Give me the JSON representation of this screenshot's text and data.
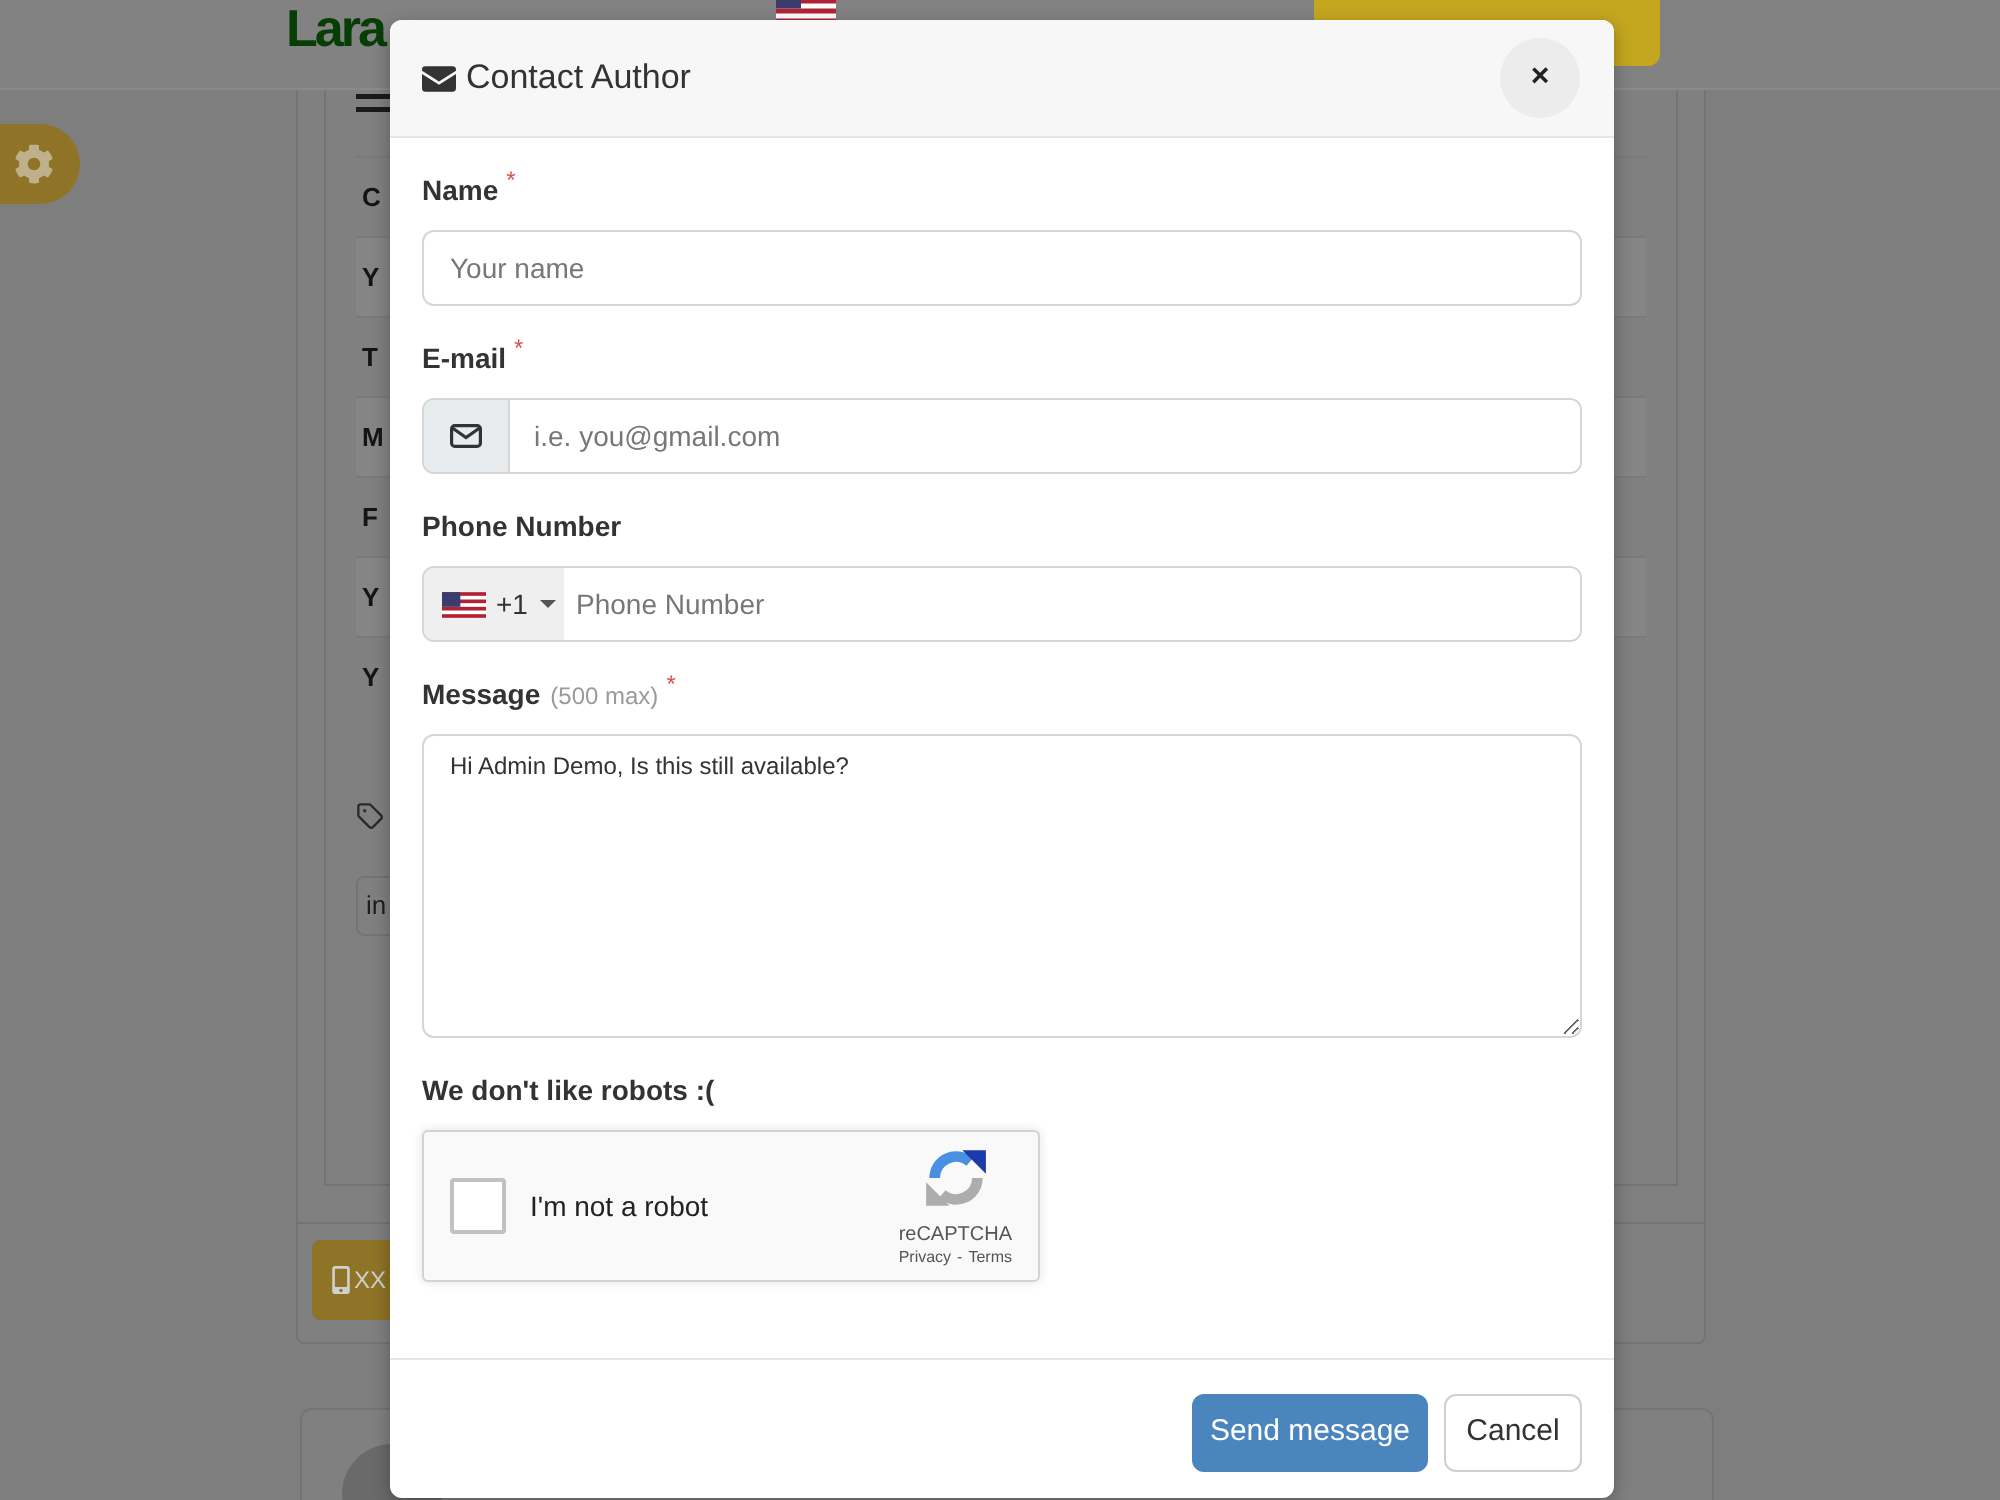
{
  "background_page": {
    "logo": "Lara",
    "detail_rows": [
      {
        "text": "C"
      },
      {
        "text": "Y"
      },
      {
        "text": "T"
      },
      {
        "text": "M"
      },
      {
        "text": "F"
      },
      {
        "text": "Y"
      },
      {
        "text": "Y"
      }
    ],
    "tag_field": {
      "value": "in"
    },
    "phone_button": {
      "label": "XX"
    }
  },
  "dialog": {
    "title": "Contact Author",
    "close_label": "×",
    "fields": [
      {
        "kind": "text",
        "label": "Name",
        "required_mark": "*",
        "placeholder": "Your name"
      },
      {
        "kind": "email",
        "label": "E-mail",
        "required_mark": "*",
        "placeholder": "i.e. you@gmail.com"
      },
      {
        "kind": "phone",
        "label": "Phone Number",
        "country_code": "+1",
        "placeholder": "Phone Number"
      },
      {
        "kind": "textarea",
        "label": "Message",
        "hint": "(500 max)",
        "required_mark": "*",
        "value": "Hi Admin Demo, Is this still available?"
      }
    ],
    "captcha": {
      "heading": "We don't like robots :(",
      "label": "I'm not a robot",
      "checked": false,
      "brand": "reCAPTCHA",
      "links": [
        "Privacy",
        "Terms"
      ],
      "link_separator": "-"
    },
    "buttons": [
      {
        "kind": "primary",
        "label": "Send message"
      },
      {
        "kind": "secondary",
        "label": "Cancel"
      }
    ]
  }
}
